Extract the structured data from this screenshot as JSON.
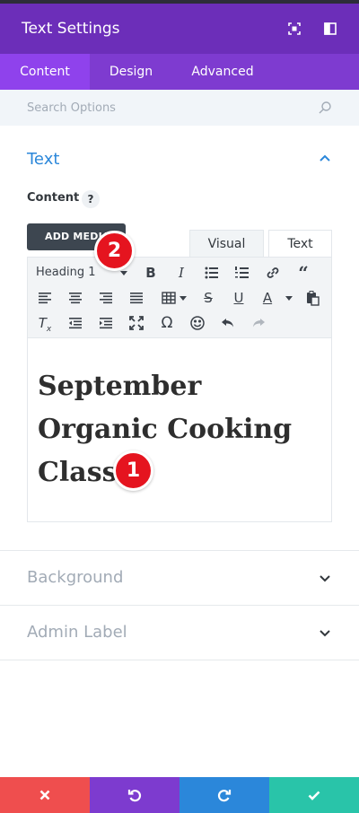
{
  "header": {
    "title": "Text Settings",
    "icons": [
      "expand-icon",
      "sidebar-toggle-icon"
    ],
    "colors": {
      "header": "#6c2eb9",
      "tabs": "#7e3bd0",
      "active_tab": "#8f42ec"
    }
  },
  "tabs": [
    {
      "label": "Content",
      "active": true
    },
    {
      "label": "Design",
      "active": false
    },
    {
      "label": "Advanced",
      "active": false
    }
  ],
  "search": {
    "placeholder": "Search Options",
    "icon": "search-icon"
  },
  "text_section": {
    "title": "Text",
    "expanded": true,
    "content_label": "Content",
    "help": "?",
    "add_media_label": "ADD MEDIA",
    "mode_tabs": {
      "visual": "Visual",
      "text": "Text",
      "active": "Visual"
    },
    "toolbar": {
      "format_select": "Heading 1",
      "row1": [
        "bold-icon",
        "italic-icon",
        "bullet-list-icon",
        "numbered-list-icon",
        "link-icon",
        "quote-icon"
      ],
      "row2": [
        "align-left-icon",
        "align-center-icon",
        "align-right-icon",
        "justify-icon",
        "table-icon",
        "strikethrough-icon",
        "underline-icon",
        "text-color-icon",
        "paste-icon"
      ],
      "row3": [
        "clear-formatting-icon",
        "outdent-icon",
        "indent-icon",
        "fullscreen-icon",
        "special-char-icon",
        "emoji-icon",
        "undo-icon",
        "redo-icon"
      ]
    },
    "editor_lines": [
      "September",
      "Organic Cooking",
      "Class"
    ]
  },
  "annotations": {
    "badge1": "1",
    "badge2": "2",
    "color": "#e5141f"
  },
  "collapsed_sections": [
    {
      "title": "Background"
    },
    {
      "title": "Admin Label"
    }
  ],
  "footer": {
    "buttons": [
      {
        "name": "cancel",
        "icon": "close-icon",
        "color": "#ef4e4e"
      },
      {
        "name": "undo",
        "icon": "undo-icon",
        "color": "#7d3bcf"
      },
      {
        "name": "redo",
        "icon": "redo-icon",
        "color": "#2b87da"
      },
      {
        "name": "save",
        "icon": "check-icon",
        "color": "#29c4a9"
      }
    ]
  }
}
